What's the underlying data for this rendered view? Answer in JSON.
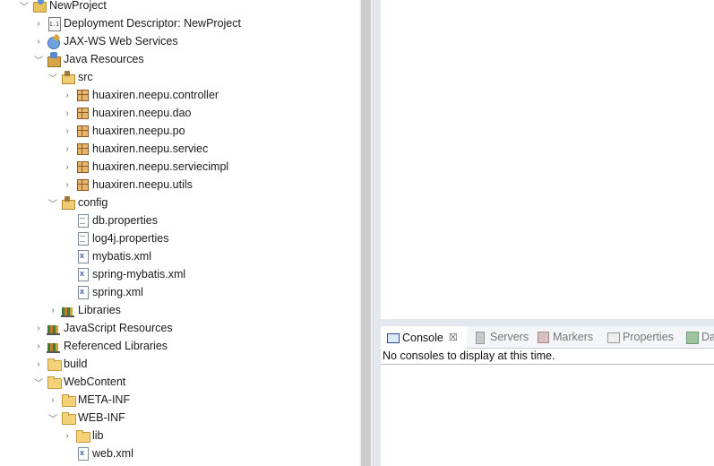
{
  "explorer": {
    "rows": [
      {
        "label": "NewProject",
        "icon": "project-icon"
      },
      {
        "label": "Deployment Descriptor: NewProject",
        "icon": "deployment-descriptor-icon"
      },
      {
        "label": "JAX-WS Web Services",
        "icon": "web-services-icon"
      },
      {
        "label": "Java Resources",
        "icon": "java-resources-icon"
      },
      {
        "label": "src",
        "icon": "source-folder-icon"
      },
      {
        "label": "huaxiren.neepu.controller",
        "icon": "package-icon"
      },
      {
        "label": "huaxiren.neepu.dao",
        "icon": "package-icon"
      },
      {
        "label": "huaxiren.neepu.po",
        "icon": "package-icon"
      },
      {
        "label": "huaxiren.neepu.serviec",
        "icon": "package-icon"
      },
      {
        "label": "huaxiren.neepu.serviecimpl",
        "icon": "package-icon"
      },
      {
        "label": "huaxiren.neepu.utils",
        "icon": "package-icon"
      },
      {
        "label": "config",
        "icon": "source-folder-icon"
      },
      {
        "label": "db.properties",
        "icon": "properties-file-icon"
      },
      {
        "label": "log4j.properties",
        "icon": "properties-file-icon"
      },
      {
        "label": "mybatis.xml",
        "icon": "xml-file-icon"
      },
      {
        "label": "spring-mybatis.xml",
        "icon": "xml-file-icon"
      },
      {
        "label": "spring.xml",
        "icon": "xml-file-icon"
      },
      {
        "label": "Libraries",
        "icon": "libraries-icon"
      },
      {
        "label": "JavaScript Resources",
        "icon": "libraries-icon"
      },
      {
        "label": "Referenced Libraries",
        "icon": "libraries-icon"
      },
      {
        "label": "build",
        "icon": "folder-icon"
      },
      {
        "label": "WebContent",
        "icon": "folder-icon"
      },
      {
        "label": "META-INF",
        "icon": "folder-icon"
      },
      {
        "label": "WEB-INF",
        "icon": "folder-icon"
      },
      {
        "label": "lib",
        "icon": "folder-icon"
      },
      {
        "label": "web.xml",
        "icon": "xml-file-icon"
      }
    ]
  },
  "panel": {
    "tabs": [
      {
        "label": "Console",
        "icon": "console-icon",
        "active": true
      },
      {
        "label": "Servers",
        "icon": "servers-icon"
      },
      {
        "label": "Markers",
        "icon": "markers-icon"
      },
      {
        "label": "Properties",
        "icon": "properties-icon"
      },
      {
        "label": "Da",
        "icon": "data-source-icon"
      }
    ],
    "close_glyph": "☒",
    "message": "No consoles to display at this time."
  }
}
